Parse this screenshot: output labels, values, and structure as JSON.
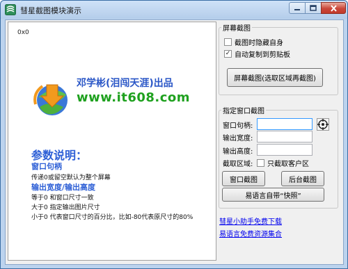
{
  "window": {
    "title": "彗星截图模块演示"
  },
  "preview": {
    "coordinates": "0x0",
    "author": "邓学彬(泪闯天涯)出品",
    "url": "www.it608.com",
    "help_title": "参数说明：",
    "help_lines": [
      {
        "text": "窗口句柄",
        "style": "heading"
      },
      {
        "text": "传递0或留空默认为整个屏幕",
        "style": "body"
      },
      {
        "text": "输出宽度/输出高度",
        "style": "heading"
      },
      {
        "text": "等于0 和窗口尺寸一致",
        "style": "body"
      },
      {
        "text": "大于0 指定输出图片尺寸",
        "style": "body"
      },
      {
        "text": "小于0 代表窗口尺寸的百分比，比如-80代表原尺寸的80%",
        "style": "body"
      }
    ]
  },
  "screen_capture": {
    "group_title": "屏幕截图",
    "hide_self_label": "截图时隐藏自身",
    "hide_self_checked": false,
    "copy_clipboard_label": "自动复制到剪贴板",
    "copy_clipboard_checked": true,
    "capture_button": "屏幕截图(选取区域再截图)"
  },
  "window_capture": {
    "group_title": "指定窗口截图",
    "handle_label": "窗口句柄:",
    "handle_value": "",
    "width_label": "输出宽度:",
    "width_value": "",
    "height_label": "输出高度:",
    "height_value": "",
    "area_label": "截取区域:",
    "client_only_label": "只截取客户区",
    "client_only_checked": false,
    "window_capture_button": "窗口截图",
    "background_capture_button": "后台截图",
    "snapshot_button": "易语言自带“快照”"
  },
  "links": {
    "download": "彗星小助手免费下载",
    "resources": "易语言免费资源集合"
  }
}
